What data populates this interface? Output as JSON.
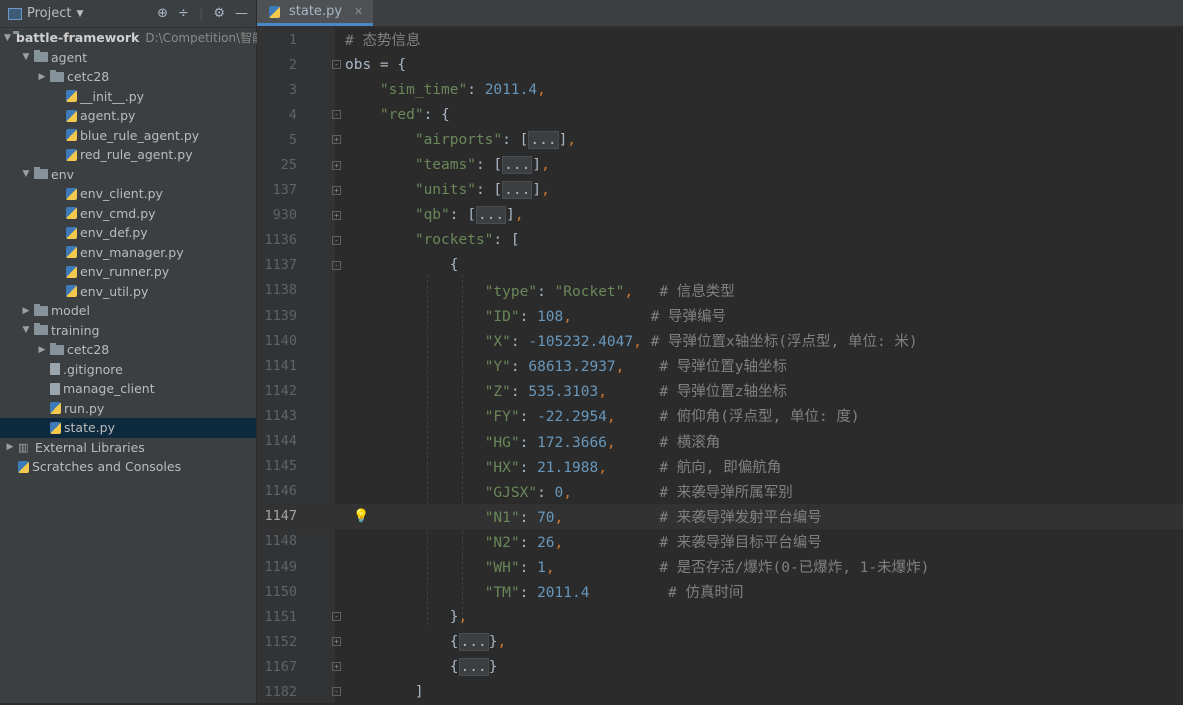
{
  "project_panel": {
    "title": "Project",
    "tree": [
      {
        "label": "battle-framework",
        "path": "D:\\Competition\\智能体",
        "depth": 0,
        "type": "folder",
        "expanded": true,
        "bold": true
      },
      {
        "label": "agent",
        "depth": 1,
        "type": "folder",
        "expanded": true
      },
      {
        "label": "cetc28",
        "depth": 2,
        "type": "folder",
        "expanded": false
      },
      {
        "label": "__init__.py",
        "depth": 3,
        "type": "py"
      },
      {
        "label": "agent.py",
        "depth": 3,
        "type": "py"
      },
      {
        "label": "blue_rule_agent.py",
        "depth": 3,
        "type": "py"
      },
      {
        "label": "red_rule_agent.py",
        "depth": 3,
        "type": "py"
      },
      {
        "label": "env",
        "depth": 1,
        "type": "folder",
        "expanded": true
      },
      {
        "label": "env_client.py",
        "depth": 3,
        "type": "py"
      },
      {
        "label": "env_cmd.py",
        "depth": 3,
        "type": "py"
      },
      {
        "label": "env_def.py",
        "depth": 3,
        "type": "py"
      },
      {
        "label": "env_manager.py",
        "depth": 3,
        "type": "py"
      },
      {
        "label": "env_runner.py",
        "depth": 3,
        "type": "py"
      },
      {
        "label": "env_util.py",
        "depth": 3,
        "type": "py"
      },
      {
        "label": "model",
        "depth": 1,
        "type": "folder",
        "expanded": false
      },
      {
        "label": "training",
        "depth": 1,
        "type": "folder",
        "expanded": true
      },
      {
        "label": "cetc28",
        "depth": 2,
        "type": "folder",
        "expanded": false
      },
      {
        "label": ".gitignore",
        "depth": 2,
        "type": "file"
      },
      {
        "label": "manage_client",
        "depth": 2,
        "type": "file"
      },
      {
        "label": "run.py",
        "depth": 2,
        "type": "py"
      },
      {
        "label": "state.py",
        "depth": 2,
        "type": "py",
        "selected": true
      },
      {
        "label": "External Libraries",
        "depth": 0,
        "type": "lib",
        "expanded": false
      },
      {
        "label": "Scratches and Consoles",
        "depth": 0,
        "type": "scratch"
      }
    ]
  },
  "editor": {
    "tab_label": "state.py",
    "current_line": "1147",
    "lines": [
      {
        "num": "1",
        "segs": [
          {
            "t": "# 态势信息",
            "c": "c"
          }
        ],
        "fold": ""
      },
      {
        "num": "2",
        "segs": [
          {
            "t": "obs = {",
            "c": ""
          }
        ],
        "fold": "-"
      },
      {
        "num": "3",
        "segs": [
          {
            "t": "    ",
            "c": ""
          },
          {
            "t": "\"sim_time\"",
            "c": "k"
          },
          {
            "t": ": ",
            "c": ""
          },
          {
            "t": "2011.4",
            "c": "n"
          },
          {
            "t": ",",
            "c": "p"
          }
        ],
        "fold": ""
      },
      {
        "num": "4",
        "segs": [
          {
            "t": "    ",
            "c": ""
          },
          {
            "t": "\"red\"",
            "c": "k"
          },
          {
            "t": ": {",
            "c": ""
          }
        ],
        "fold": "-"
      },
      {
        "num": "5",
        "segs": [
          {
            "t": "        ",
            "c": ""
          },
          {
            "t": "\"airports\"",
            "c": "k"
          },
          {
            "t": ": [",
            "c": ""
          },
          {
            "t": "...",
            "c": "fd"
          },
          {
            "t": "]",
            "c": ""
          },
          {
            "t": ",",
            "c": "p"
          }
        ],
        "fold": "+"
      },
      {
        "num": "25",
        "segs": [
          {
            "t": "        ",
            "c": ""
          },
          {
            "t": "\"teams\"",
            "c": "k"
          },
          {
            "t": ": [",
            "c": ""
          },
          {
            "t": "...",
            "c": "fd"
          },
          {
            "t": "]",
            "c": ""
          },
          {
            "t": ",",
            "c": "p"
          }
        ],
        "fold": "+"
      },
      {
        "num": "137",
        "segs": [
          {
            "t": "        ",
            "c": ""
          },
          {
            "t": "\"units\"",
            "c": "k"
          },
          {
            "t": ": [",
            "c": ""
          },
          {
            "t": "...",
            "c": "fd"
          },
          {
            "t": "]",
            "c": ""
          },
          {
            "t": ",",
            "c": "p"
          }
        ],
        "fold": "+"
      },
      {
        "num": "930",
        "segs": [
          {
            "t": "        ",
            "c": ""
          },
          {
            "t": "\"qb\"",
            "c": "k"
          },
          {
            "t": ": [",
            "c": ""
          },
          {
            "t": "...",
            "c": "fd"
          },
          {
            "t": "]",
            "c": ""
          },
          {
            "t": ",",
            "c": "p"
          }
        ],
        "fold": "+"
      },
      {
        "num": "1136",
        "segs": [
          {
            "t": "        ",
            "c": ""
          },
          {
            "t": "\"rockets\"",
            "c": "k"
          },
          {
            "t": ": [",
            "c": ""
          }
        ],
        "fold": "-"
      },
      {
        "num": "1137",
        "segs": [
          {
            "t": "            {",
            "c": ""
          }
        ],
        "fold": "-"
      },
      {
        "num": "1138",
        "segs": [
          {
            "t": "                ",
            "c": ""
          },
          {
            "t": "\"type\"",
            "c": "k"
          },
          {
            "t": ": ",
            "c": ""
          },
          {
            "t": "\"Rocket\"",
            "c": "k"
          },
          {
            "t": ",",
            "c": "p"
          },
          {
            "t": "   ",
            "c": ""
          },
          {
            "t": "# 信息类型",
            "c": "c"
          }
        ],
        "fold": ""
      },
      {
        "num": "1139",
        "segs": [
          {
            "t": "                ",
            "c": ""
          },
          {
            "t": "\"ID\"",
            "c": "k"
          },
          {
            "t": ": ",
            "c": ""
          },
          {
            "t": "108",
            "c": "n"
          },
          {
            "t": ",",
            "c": "p"
          },
          {
            "t": "         ",
            "c": ""
          },
          {
            "t": "# 导弹编号",
            "c": "c"
          }
        ],
        "fold": ""
      },
      {
        "num": "1140",
        "segs": [
          {
            "t": "                ",
            "c": ""
          },
          {
            "t": "\"X\"",
            "c": "k"
          },
          {
            "t": ": ",
            "c": ""
          },
          {
            "t": "-105232.4047",
            "c": "n"
          },
          {
            "t": ",",
            "c": "p"
          },
          {
            "t": " ",
            "c": ""
          },
          {
            "t": "# 导弹位置x轴坐标(浮点型, 单位: 米)",
            "c": "c"
          }
        ],
        "fold": ""
      },
      {
        "num": "1141",
        "segs": [
          {
            "t": "                ",
            "c": ""
          },
          {
            "t": "\"Y\"",
            "c": "k"
          },
          {
            "t": ": ",
            "c": ""
          },
          {
            "t": "68613.2937",
            "c": "n"
          },
          {
            "t": ",",
            "c": "p"
          },
          {
            "t": "    ",
            "c": ""
          },
          {
            "t": "# 导弹位置y轴坐标",
            "c": "c"
          }
        ],
        "fold": ""
      },
      {
        "num": "1142",
        "segs": [
          {
            "t": "                ",
            "c": ""
          },
          {
            "t": "\"Z\"",
            "c": "k"
          },
          {
            "t": ": ",
            "c": ""
          },
          {
            "t": "535.3103",
            "c": "n"
          },
          {
            "t": ",",
            "c": "p"
          },
          {
            "t": "      ",
            "c": ""
          },
          {
            "t": "# 导弹位置z轴坐标",
            "c": "c"
          }
        ],
        "fold": ""
      },
      {
        "num": "1143",
        "segs": [
          {
            "t": "                ",
            "c": ""
          },
          {
            "t": "\"FY\"",
            "c": "k"
          },
          {
            "t": ": ",
            "c": ""
          },
          {
            "t": "-22.2954",
            "c": "n"
          },
          {
            "t": ",",
            "c": "p"
          },
          {
            "t": "     ",
            "c": ""
          },
          {
            "t": "# 俯仰角(浮点型, 单位: 度)",
            "c": "c"
          }
        ],
        "fold": ""
      },
      {
        "num": "1144",
        "segs": [
          {
            "t": "                ",
            "c": ""
          },
          {
            "t": "\"HG\"",
            "c": "k"
          },
          {
            "t": ": ",
            "c": ""
          },
          {
            "t": "172.3666",
            "c": "n"
          },
          {
            "t": ",",
            "c": "p"
          },
          {
            "t": "     ",
            "c": ""
          },
          {
            "t": "# 横滚角",
            "c": "c"
          }
        ],
        "fold": ""
      },
      {
        "num": "1145",
        "segs": [
          {
            "t": "                ",
            "c": ""
          },
          {
            "t": "\"HX\"",
            "c": "k"
          },
          {
            "t": ": ",
            "c": ""
          },
          {
            "t": "21.1988",
            "c": "n"
          },
          {
            "t": ",",
            "c": "p"
          },
          {
            "t": "      ",
            "c": ""
          },
          {
            "t": "# 航向, 即偏航角",
            "c": "c"
          }
        ],
        "fold": ""
      },
      {
        "num": "1146",
        "segs": [
          {
            "t": "                ",
            "c": ""
          },
          {
            "t": "\"GJSX\"",
            "c": "k"
          },
          {
            "t": ": ",
            "c": ""
          },
          {
            "t": "0",
            "c": "n"
          },
          {
            "t": ",",
            "c": "p"
          },
          {
            "t": "          ",
            "c": ""
          },
          {
            "t": "# 来袭导弹所属军别",
            "c": "c"
          }
        ],
        "fold": ""
      },
      {
        "num": "1147",
        "segs": [
          {
            "t": "                ",
            "c": ""
          },
          {
            "t": "\"N1\"",
            "c": "k"
          },
          {
            "t": ": ",
            "c": ""
          },
          {
            "t": "70",
            "c": "n"
          },
          {
            "t": ",",
            "c": "p"
          },
          {
            "t": "           ",
            "c": ""
          },
          {
            "t": "# 来袭导弹发射平台编号",
            "c": "c"
          }
        ],
        "fold": "",
        "bulb": true
      },
      {
        "num": "1148",
        "segs": [
          {
            "t": "                ",
            "c": ""
          },
          {
            "t": "\"N2\"",
            "c": "k"
          },
          {
            "t": ": ",
            "c": ""
          },
          {
            "t": "26",
            "c": "n"
          },
          {
            "t": ",",
            "c": "p"
          },
          {
            "t": "           ",
            "c": ""
          },
          {
            "t": "# 来袭导弹目标平台编号",
            "c": "c"
          }
        ],
        "fold": ""
      },
      {
        "num": "1149",
        "segs": [
          {
            "t": "                ",
            "c": ""
          },
          {
            "t": "\"WH\"",
            "c": "k"
          },
          {
            "t": ": ",
            "c": ""
          },
          {
            "t": "1",
            "c": "n"
          },
          {
            "t": ",",
            "c": "p"
          },
          {
            "t": "            ",
            "c": ""
          },
          {
            "t": "# 是否存活/爆炸(0-已爆炸, 1-未爆炸)",
            "c": "c"
          }
        ],
        "fold": ""
      },
      {
        "num": "1150",
        "segs": [
          {
            "t": "                ",
            "c": ""
          },
          {
            "t": "\"TM\"",
            "c": "k"
          },
          {
            "t": ": ",
            "c": ""
          },
          {
            "t": "2011.4",
            "c": "n"
          },
          {
            "t": "         ",
            "c": ""
          },
          {
            "t": "# 仿真时间",
            "c": "c"
          }
        ],
        "fold": ""
      },
      {
        "num": "1151",
        "segs": [
          {
            "t": "            }",
            "c": ""
          },
          {
            "t": ",",
            "c": "p"
          }
        ],
        "fold": "-"
      },
      {
        "num": "1152",
        "segs": [
          {
            "t": "            {",
            "c": ""
          },
          {
            "t": "...",
            "c": "fd"
          },
          {
            "t": "}",
            "c": ""
          },
          {
            "t": ",",
            "c": "p"
          }
        ],
        "fold": "+"
      },
      {
        "num": "1167",
        "segs": [
          {
            "t": "            {",
            "c": ""
          },
          {
            "t": "...",
            "c": "fd"
          },
          {
            "t": "}",
            "c": ""
          }
        ],
        "fold": "+"
      },
      {
        "num": "1182",
        "segs": [
          {
            "t": "        ]",
            "c": ""
          }
        ],
        "fold": "-"
      }
    ]
  },
  "colors": {
    "string": "#6a8759",
    "number": "#6897bb",
    "comment": "#808080",
    "keyword": "#cc7832",
    "text": "#a9b7c6"
  }
}
